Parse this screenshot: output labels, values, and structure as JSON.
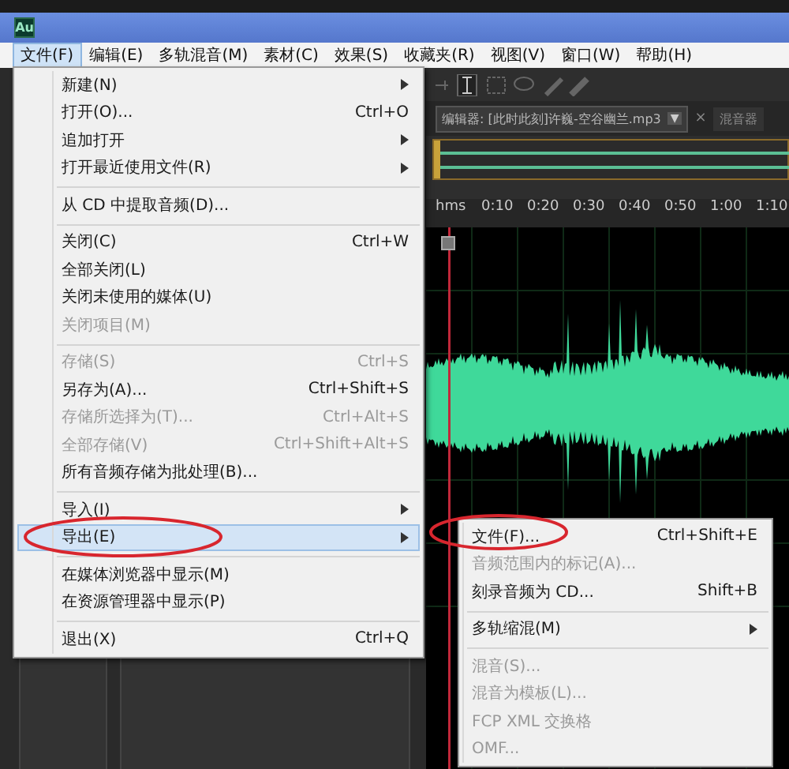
{
  "window": {
    "app_icon": "Au"
  },
  "menubar": [
    {
      "label": "文件(F)",
      "selected": true
    },
    {
      "label": "编辑(E)",
      "selected": false
    },
    {
      "label": "多轨混音(M)",
      "selected": false
    },
    {
      "label": "素材(C)",
      "selected": false
    },
    {
      "label": "效果(S)",
      "selected": false
    },
    {
      "label": "收藏夹(R)",
      "selected": false
    },
    {
      "label": "视图(V)",
      "selected": false
    },
    {
      "label": "窗口(W)",
      "selected": false
    },
    {
      "label": "帮助(H)",
      "selected": false
    }
  ],
  "file_menu": {
    "sections": [
      {
        "items": [
          {
            "label": "新建(N)",
            "submenu": true,
            "disabled": false,
            "selected": false
          },
          {
            "label": "打开(O)...",
            "shortcut": "Ctrl+O",
            "submenu": false,
            "disabled": false,
            "selected": false
          },
          {
            "label": "追加打开",
            "submenu": true,
            "disabled": false,
            "selected": false
          },
          {
            "label": "打开最近使用文件(R)",
            "submenu": true,
            "disabled": false,
            "selected": false
          }
        ]
      },
      {
        "items": [
          {
            "label": "从 CD 中提取音频(D)...",
            "submenu": false,
            "disabled": false,
            "selected": false
          }
        ]
      },
      {
        "items": [
          {
            "label": "关闭(C)",
            "shortcut": "Ctrl+W",
            "submenu": false,
            "disabled": false,
            "selected": false
          },
          {
            "label": "全部关闭(L)",
            "submenu": false,
            "disabled": false,
            "selected": false
          },
          {
            "label": "关闭未使用的媒体(U)",
            "submenu": false,
            "disabled": false,
            "selected": false
          },
          {
            "label": "关闭项目(M)",
            "submenu": false,
            "disabled": true,
            "selected": false
          }
        ]
      },
      {
        "items": [
          {
            "label": "存储(S)",
            "shortcut": "Ctrl+S",
            "submenu": false,
            "disabled": true,
            "selected": false
          },
          {
            "label": "另存为(A)...",
            "shortcut": "Ctrl+Shift+S",
            "submenu": false,
            "disabled": false,
            "selected": false
          },
          {
            "label": "存储所选择为(T)...",
            "shortcut": "Ctrl+Alt+S",
            "submenu": false,
            "disabled": true,
            "selected": false
          },
          {
            "label": "全部存储(V)",
            "shortcut": "Ctrl+Shift+Alt+S",
            "submenu": false,
            "disabled": true,
            "selected": false
          },
          {
            "label": "所有音频存储为批处理(B)...",
            "submenu": false,
            "disabled": false,
            "selected": false
          }
        ]
      },
      {
        "items": [
          {
            "label": "导入(I)",
            "submenu": true,
            "disabled": false,
            "selected": false
          },
          {
            "label": "导出(E)",
            "submenu": true,
            "disabled": false,
            "selected": true
          }
        ]
      },
      {
        "items": [
          {
            "label": "在媒体浏览器中显示(M)",
            "submenu": false,
            "disabled": false,
            "selected": false
          },
          {
            "label": "在资源管理器中显示(P)",
            "submenu": false,
            "disabled": false,
            "selected": false
          }
        ]
      },
      {
        "items": [
          {
            "label": "退出(X)",
            "shortcut": "Ctrl+Q",
            "submenu": false,
            "disabled": false,
            "selected": false
          }
        ]
      }
    ]
  },
  "export_menu": {
    "sections": [
      {
        "items": [
          {
            "label": "文件(F)...",
            "shortcut": "Ctrl+Shift+E",
            "submenu": false,
            "disabled": false,
            "selected": false
          },
          {
            "label": "音频范围内的标记(A)...",
            "submenu": false,
            "disabled": true,
            "selected": false
          },
          {
            "label": "刻录音频为 CD...",
            "shortcut": "Shift+B",
            "submenu": false,
            "disabled": false,
            "selected": false
          }
        ]
      },
      {
        "items": [
          {
            "label": "多轨缩混(M)",
            "submenu": true,
            "disabled": false,
            "selected": false
          }
        ]
      },
      {
        "items": [
          {
            "label": "混音(S)...",
            "submenu": false,
            "disabled": true,
            "selected": false
          },
          {
            "label": "混音为模板(L)...",
            "submenu": false,
            "disabled": true,
            "selected": false
          },
          {
            "label": "FCP XML 交换格",
            "submenu": false,
            "disabled": true,
            "selected": false
          },
          {
            "label": "OMF...",
            "submenu": false,
            "disabled": true,
            "selected": false
          }
        ]
      }
    ]
  },
  "editor": {
    "tab": {
      "label": "编辑器: [此时此刻]许巍-空谷幽兰.mp3",
      "dropdown": "▼",
      "close": "×"
    },
    "mixer_tab": {
      "label": "混音器"
    },
    "ruler": [
      "hms",
      "0:10",
      "0:20",
      "0:30",
      "0:40",
      "0:50",
      "1:00",
      "1:10"
    ]
  }
}
